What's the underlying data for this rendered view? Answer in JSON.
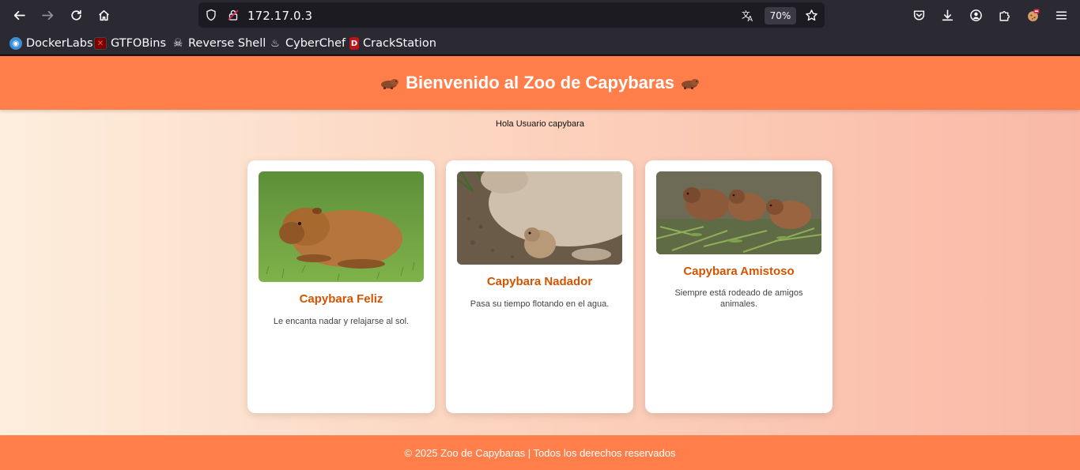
{
  "browser": {
    "url": "172.17.0.3",
    "zoom": "70%",
    "bookmarks": [
      {
        "label": "DockerLabs",
        "icon": "docker-icon"
      },
      {
        "label": "GTFOBins",
        "icon": "gtfobins-icon"
      },
      {
        "label": "Reverse Shell",
        "icon": "skull-icon"
      },
      {
        "label": "CyberChef",
        "icon": "chef-hat-icon"
      },
      {
        "label": "CrackStation",
        "icon": "crackstation-icon"
      }
    ]
  },
  "page": {
    "title": "Bienvenido al Zoo de Capybaras",
    "greeting": "Hola Usuario capybara",
    "cards": [
      {
        "title": "Capybara Feliz",
        "description": "Le encanta nadar y relajarse al sol."
      },
      {
        "title": "Capybara Nadador",
        "description": "Pasa su tiempo flotando en el agua."
      },
      {
        "title": "Capybara Amistoso",
        "description": "Siempre está rodeado de amigos animales."
      }
    ],
    "footer": "© 2025 Zoo de Capybaras | Todos los derechos reservados"
  },
  "colors": {
    "header": "#ff7e4a",
    "card_title": "#d35400"
  }
}
